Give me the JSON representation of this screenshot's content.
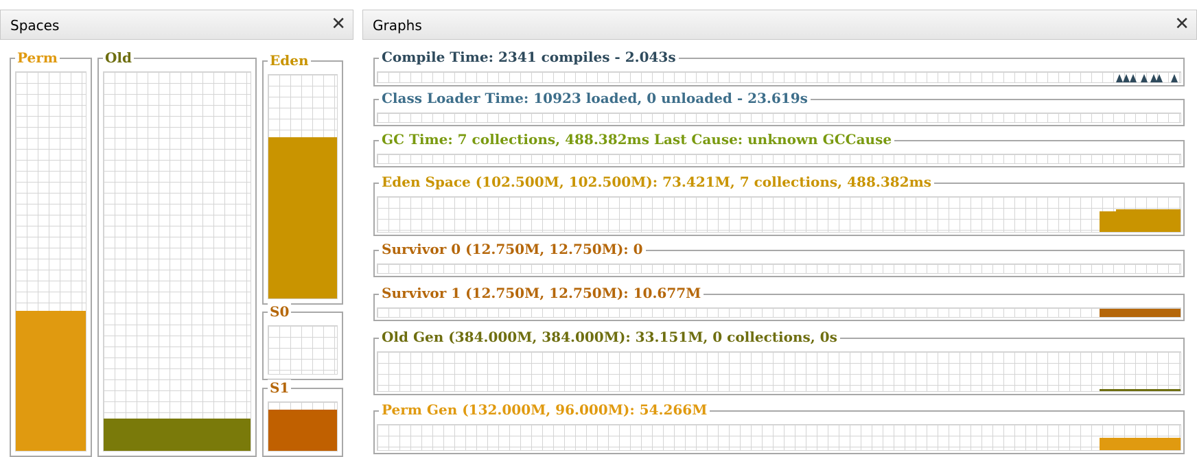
{
  "spaces": {
    "title": "Spaces",
    "close": "✕",
    "perm": {
      "label": "Perm",
      "color": "#e09a10",
      "fill_fraction": 0.37
    },
    "old": {
      "label": "Old",
      "color": "#7a7a0a",
      "fill_fraction": 0.085
    },
    "eden": {
      "label": "Eden",
      "color": "#c99400",
      "fill_fraction": 0.72
    },
    "s0": {
      "label": "S0",
      "color": "#c06000",
      "fill_fraction": 0
    },
    "s1": {
      "label": "S1",
      "color": "#c06000",
      "fill_fraction": 0.84
    }
  },
  "graphs": {
    "title": "Graphs",
    "close": "✕",
    "rows": [
      {
        "label": "Compile Time: 2341 compiles - 2.043s",
        "color": "#2e4a5c"
      },
      {
        "label": "Class Loader Time: 10923 loaded, 0 unloaded - 23.619s",
        "color": "#3d6e8a"
      },
      {
        "label": "GC Time: 7 collections, 488.382ms Last Cause: unknown GCCause",
        "color": "#7a9a10"
      },
      {
        "label": "Eden Space (102.500M, 102.500M): 73.421M, 7 collections, 488.382ms",
        "color": "#c99400"
      },
      {
        "label": "Survivor 0 (12.750M, 12.750M): 0",
        "color": "#b5670a"
      },
      {
        "label": "Survivor 1 (12.750M, 12.750M): 10.677M",
        "color": "#b5670a"
      },
      {
        "label": "Old Gen (384.000M, 384.000M): 33.151M, 0 collections, 0s",
        "color": "#6e6e10"
      },
      {
        "label": "Perm Gen (132.000M, 96.000M): 54.266M",
        "color": "#e09a10"
      }
    ]
  }
}
